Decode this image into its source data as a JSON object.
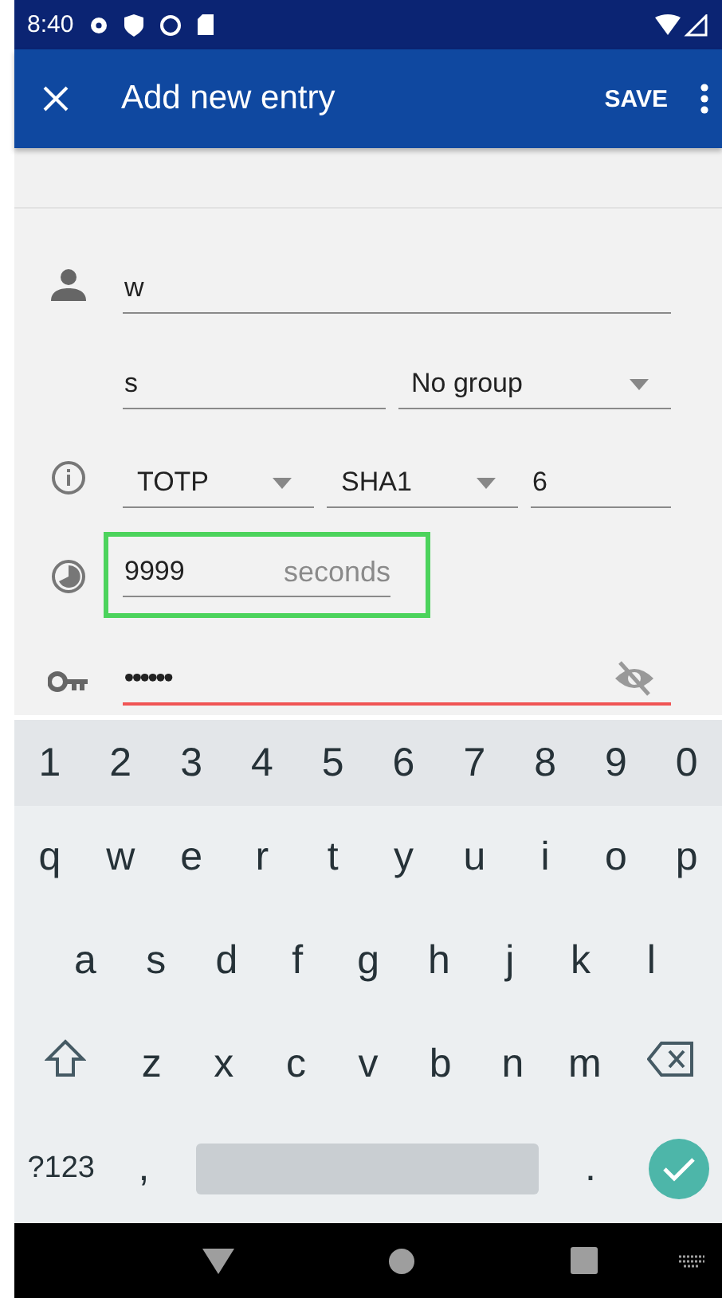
{
  "status_bar": {
    "time": "8:40"
  },
  "app_bar": {
    "title": "Add new entry",
    "action": "SAVE"
  },
  "form": {
    "name": {
      "value": "w"
    },
    "issuer": {
      "value": "s"
    },
    "group": {
      "value": "No group"
    },
    "otp_type": {
      "value": "TOTP"
    },
    "algorithm": {
      "value": "SHA1"
    },
    "digits": {
      "value": "6"
    },
    "period": {
      "value": "9999",
      "suffix": "seconds",
      "highlighted": true
    },
    "secret": {
      "value": "••••••",
      "error": true
    }
  },
  "keyboard": {
    "rows": [
      {
        "kind": "number",
        "keys": [
          {
            "kind": "char",
            "label": "1"
          },
          {
            "kind": "char",
            "label": "2"
          },
          {
            "kind": "char",
            "label": "3"
          },
          {
            "kind": "char",
            "label": "4"
          },
          {
            "kind": "char",
            "label": "5"
          },
          {
            "kind": "char",
            "label": "6"
          },
          {
            "kind": "char",
            "label": "7"
          },
          {
            "kind": "char",
            "label": "8"
          },
          {
            "kind": "char",
            "label": "9"
          },
          {
            "kind": "char",
            "label": "0"
          }
        ]
      },
      {
        "kind": "letter",
        "keys": [
          {
            "kind": "char",
            "label": "q"
          },
          {
            "kind": "char",
            "label": "w"
          },
          {
            "kind": "char",
            "label": "e"
          },
          {
            "kind": "char",
            "label": "r"
          },
          {
            "kind": "char",
            "label": "t"
          },
          {
            "kind": "char",
            "label": "y"
          },
          {
            "kind": "char",
            "label": "u"
          },
          {
            "kind": "char",
            "label": "i"
          },
          {
            "kind": "char",
            "label": "o"
          },
          {
            "kind": "char",
            "label": "p"
          }
        ]
      },
      {
        "kind": "letter",
        "keys": [
          {
            "kind": "gap"
          },
          {
            "kind": "char",
            "label": "a"
          },
          {
            "kind": "char",
            "label": "s"
          },
          {
            "kind": "char",
            "label": "d"
          },
          {
            "kind": "char",
            "label": "f"
          },
          {
            "kind": "char",
            "label": "g"
          },
          {
            "kind": "char",
            "label": "h"
          },
          {
            "kind": "char",
            "label": "j"
          },
          {
            "kind": "char",
            "label": "k"
          },
          {
            "kind": "char",
            "label": "l"
          },
          {
            "kind": "gap"
          }
        ]
      },
      {
        "kind": "letter",
        "keys": [
          {
            "kind": "shift"
          },
          {
            "kind": "char",
            "label": "z"
          },
          {
            "kind": "char",
            "label": "x"
          },
          {
            "kind": "char",
            "label": "c"
          },
          {
            "kind": "char",
            "label": "v"
          },
          {
            "kind": "char",
            "label": "b"
          },
          {
            "kind": "char",
            "label": "n"
          },
          {
            "kind": "char",
            "label": "m"
          },
          {
            "kind": "backspace"
          }
        ]
      },
      {
        "kind": "bottom",
        "keys": [
          {
            "kind": "symbols",
            "label": "?123"
          },
          {
            "kind": "char",
            "label": ","
          },
          {
            "kind": "space"
          },
          {
            "kind": "char",
            "label": "."
          },
          {
            "kind": "enter"
          }
        ]
      }
    ]
  }
}
